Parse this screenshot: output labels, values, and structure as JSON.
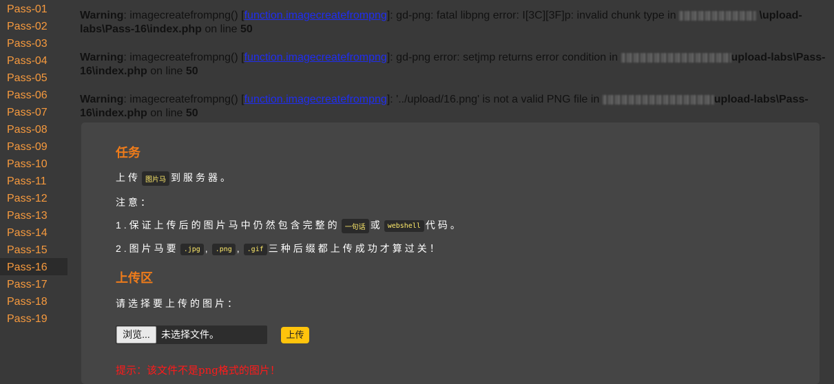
{
  "sidebar": {
    "items": [
      "Pass-01",
      "Pass-02",
      "Pass-03",
      "Pass-04",
      "Pass-05",
      "Pass-06",
      "Pass-07",
      "Pass-08",
      "Pass-09",
      "Pass-10",
      "Pass-11",
      "Pass-12",
      "Pass-13",
      "Pass-14",
      "Pass-15",
      "Pass-16",
      "Pass-17",
      "Pass-18",
      "Pass-19"
    ],
    "active": "Pass-16"
  },
  "warnings": [
    {
      "label": "Warning",
      "prefix": ": imagecreatefrompng() [",
      "link": "function.imagecreatefrompng",
      "message": "]: gd-png: fatal libpng error: I[3C][3F]p: invalid chunk type in ",
      "path": "\\upload-labs\\Pass-16\\index.php",
      "on_line": " on line ",
      "line": "50"
    },
    {
      "label": "Warning",
      "prefix": ": imagecreatefrompng() [",
      "link": "function.imagecreatefrompng",
      "message": "]: gd-png error: setjmp returns error condition in ",
      "path": "upload-labs\\Pass-16\\index.php",
      "on_line": " on line ",
      "line": "50"
    },
    {
      "label": "Warning",
      "prefix": ": imagecreatefrompng() [",
      "link": "function.imagecreatefrompng",
      "message": "]: '../upload/16.png' is not a valid PNG file in ",
      "path": "upload-labs\\Pass-16\\index.php",
      "on_line": " on line ",
      "line": "50"
    }
  ],
  "task": {
    "title": "任务",
    "line1_a": "上传",
    "line1_code": "图片马",
    "line1_b": "到服务器。",
    "note": "注意：",
    "rule1_a": "1.保证上传后的图片马中仍然包含完整的",
    "rule1_code1": "一句话",
    "rule1_or": "或",
    "rule1_code2": "webshell",
    "rule1_b": "代码。",
    "rule2_a": "2.图片马要",
    "rule2_code1": ".jpg",
    "rule2_sep1": ",",
    "rule2_code2": ".png",
    "rule2_sep2": ",",
    "rule2_code3": ".gif",
    "rule2_b": "三种后缀都上传成功才算过关！"
  },
  "upload": {
    "title": "上传区",
    "prompt": "请选择要上传的图片：",
    "browse_label": "浏览...",
    "file_status": "未选择文件。",
    "submit_label": "上传",
    "hint": "提示：该文件不是png格式的图片！"
  },
  "colors": {
    "accent": "#f07c1a",
    "sidebar_link": "#f79a3e",
    "button": "#ffc40c",
    "error": "#ff1a1a",
    "link": "#1f2df1"
  }
}
